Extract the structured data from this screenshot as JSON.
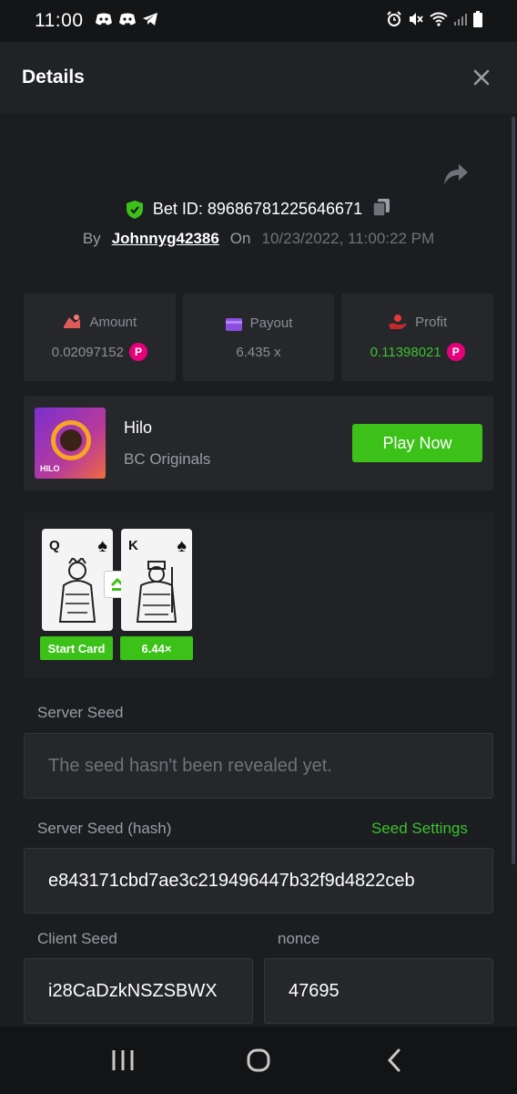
{
  "status_bar": {
    "time": "11:00"
  },
  "header": {
    "title": "Details"
  },
  "bet": {
    "id_label": "Bet ID: 89686781225646671",
    "by_label": "By",
    "username": "Johnnyg42386",
    "on_label": "On",
    "datetime": "10/23/2022, 11:00:22 PM"
  },
  "stats": {
    "amount": {
      "label": "Amount",
      "value": "0.02097152"
    },
    "payout": {
      "label": "Payout",
      "value": "6.435 x"
    },
    "profit": {
      "label": "Profit",
      "value": "0.11398021"
    },
    "coin_symbol": "P"
  },
  "game": {
    "name": "Hilo",
    "provider": "BC Originals",
    "thumb_text": "HILO",
    "play_label": "Play Now"
  },
  "cards": [
    {
      "rank": "Q",
      "suit": "♠",
      "tag": "Start Card"
    },
    {
      "rank": "K",
      "suit": "♠",
      "tag": "6.44×"
    }
  ],
  "seeds": {
    "server_seed_label": "Server Seed",
    "server_seed_placeholder": "The seed hasn't been revealed yet.",
    "server_hash_label": "Server Seed (hash)",
    "seed_settings_label": "Seed Settings",
    "server_hash_value": "e843171cbd7ae3c219496447b32f9d4822ceb",
    "client_seed_label": "Client Seed",
    "client_seed_value": "i28CaDzkNSZSBWX",
    "nonce_label": "nonce",
    "nonce_value": "47695"
  },
  "colors": {
    "accent_green": "#3bc117",
    "coin_pink": "#e6007a",
    "background": "#1b1d21"
  }
}
